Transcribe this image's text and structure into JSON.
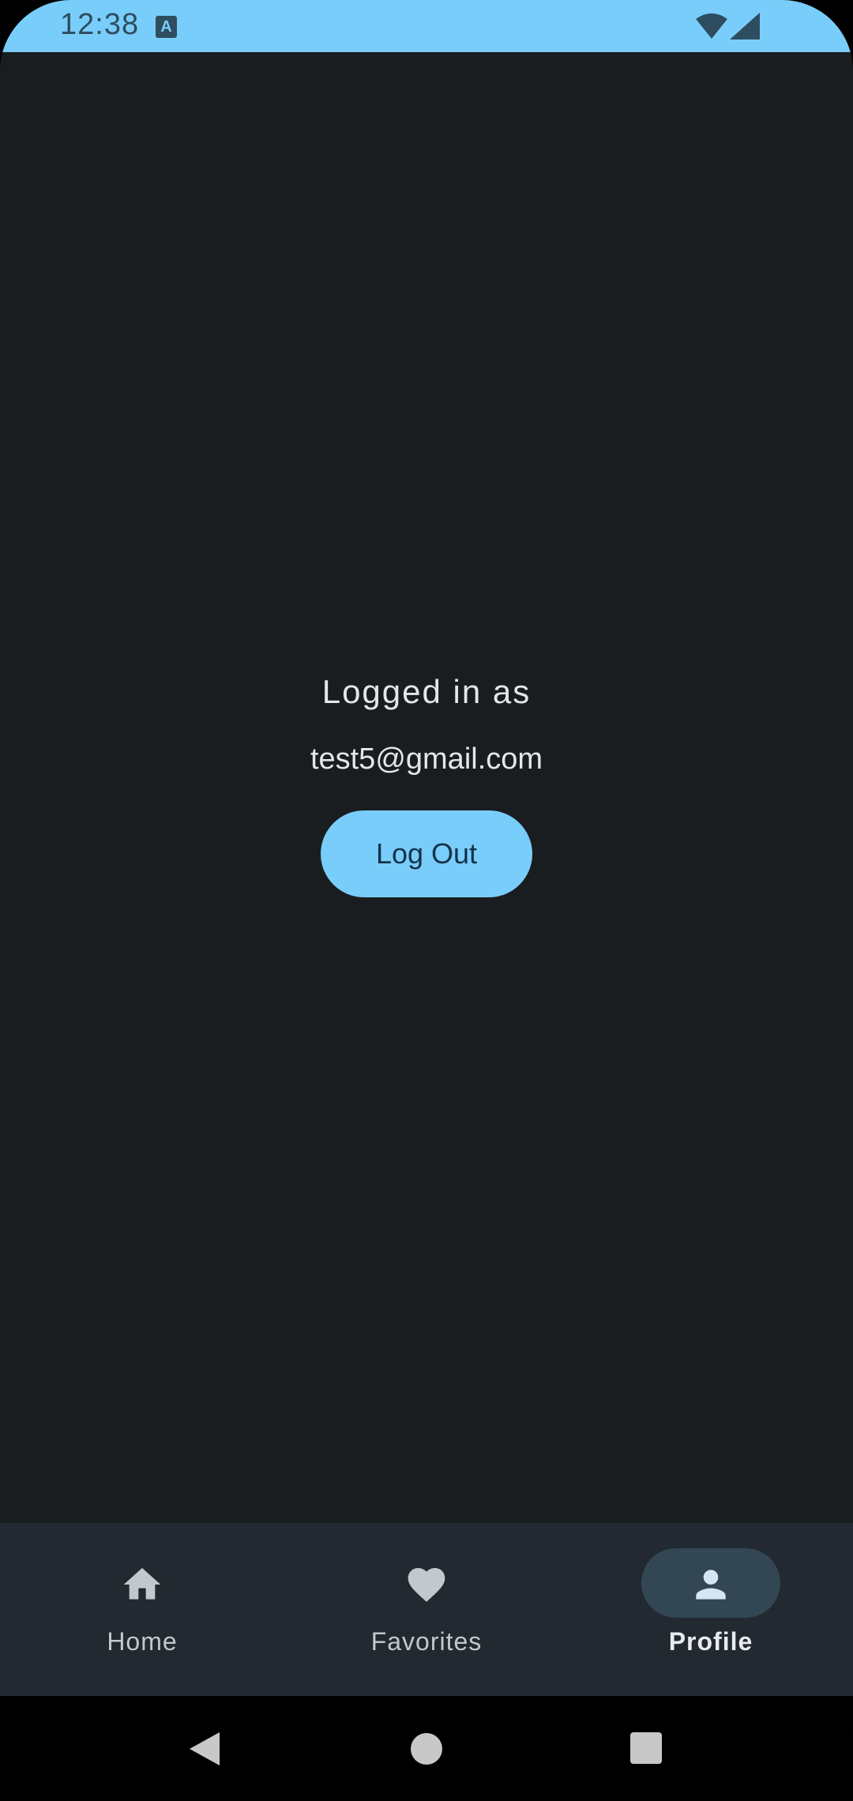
{
  "status_bar": {
    "time": "12:38",
    "notification_icon": "a-icon",
    "wifi_icon": "wifi-icon",
    "signal_icon": "signal-icon",
    "background_color": "#79cdfa"
  },
  "profile": {
    "logged_in_label": "Logged in as",
    "email": "test5@gmail.com",
    "logout_label": "Log Out"
  },
  "bottom_nav": {
    "items": [
      {
        "label": "Home",
        "icon": "home-icon",
        "active": false
      },
      {
        "label": "Favorites",
        "icon": "heart-icon",
        "active": false
      },
      {
        "label": "Profile",
        "icon": "person-icon",
        "active": true
      }
    ]
  },
  "system_nav": {
    "back_icon": "back-icon",
    "home_icon": "home-circle-icon",
    "recents_icon": "recents-icon"
  },
  "colors": {
    "accent": "#79cdfa",
    "background": "#1a1d20",
    "nav_background": "#222930",
    "active_pill": "#334653"
  }
}
